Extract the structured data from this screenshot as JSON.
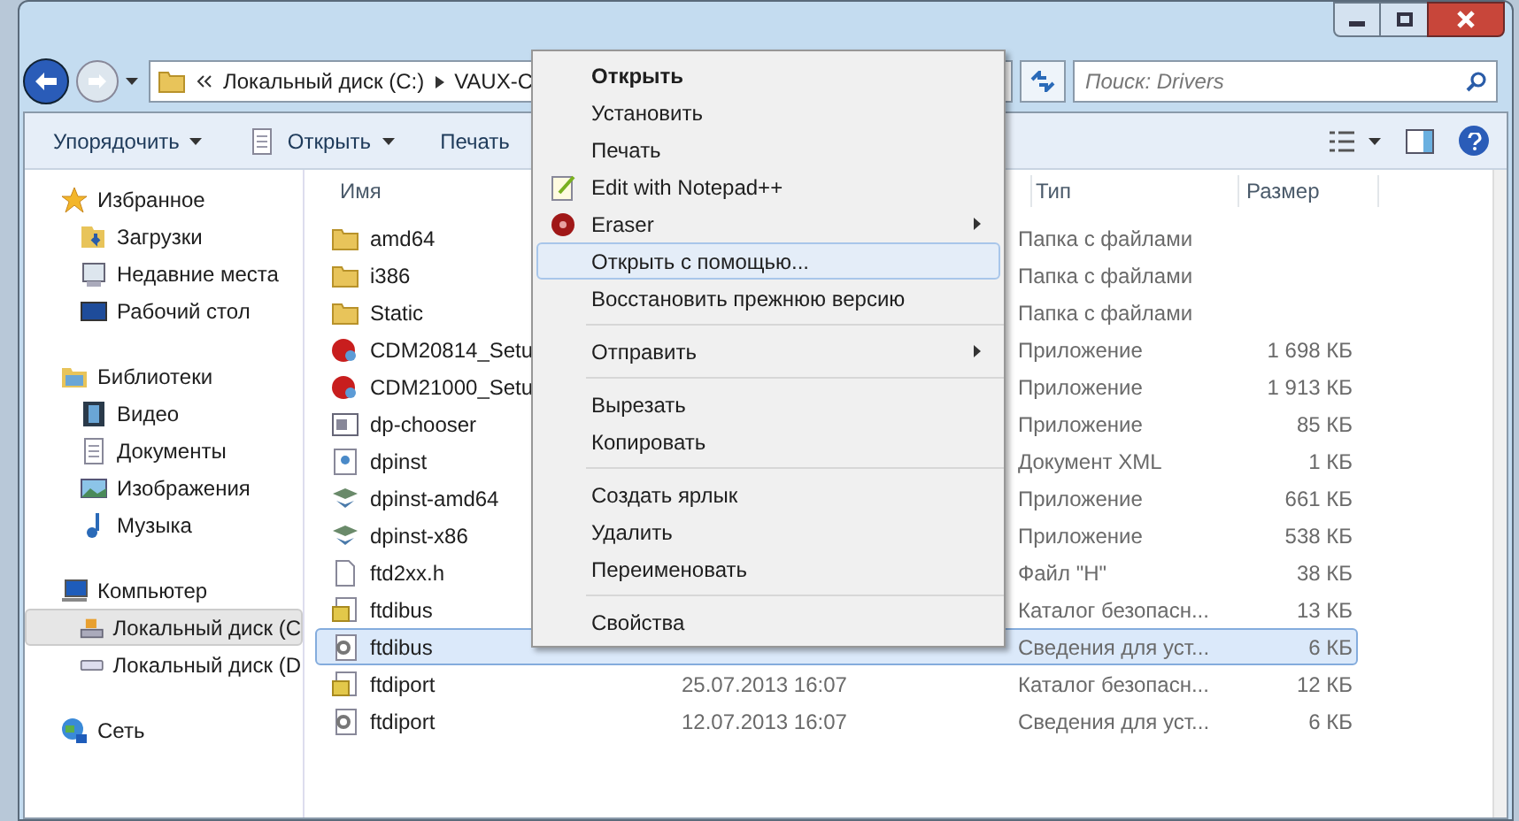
{
  "address_bar": {
    "parts": [
      "Локальный диск (C:)",
      "VAUX-C"
    ]
  },
  "search": {
    "placeholder": "Поиск: Drivers"
  },
  "toolbar": [
    {
      "label": "Упорядочить",
      "kind": "menu"
    },
    {
      "label": "Открыть",
      "kind": "open"
    },
    {
      "label": "Печать",
      "kind": "plain"
    }
  ],
  "sidebar": {
    "groups": [
      {
        "label": "Избранное",
        "children": [
          {
            "label": "Загрузки",
            "selected": false
          },
          {
            "label": "Недавние места",
            "selected": false
          },
          {
            "label": "Рабочий стол",
            "selected": false
          }
        ]
      },
      {
        "label": "Библиотеки",
        "children": [
          {
            "label": "Видео",
            "selected": false
          },
          {
            "label": "Документы",
            "selected": false
          },
          {
            "label": "Изображения",
            "selected": false
          },
          {
            "label": "Музыка",
            "selected": false
          }
        ]
      },
      {
        "label": "Компьютер",
        "children": [
          {
            "label": "Локальный диск (C",
            "selected": true
          },
          {
            "label": "Локальный диск (D",
            "selected": false
          }
        ]
      },
      {
        "label": "Сеть"
      }
    ]
  },
  "table": {
    "columns": [
      "Имя",
      "Тип",
      "Размер"
    ],
    "rows": [
      {
        "name": "amd64",
        "kind": "folder",
        "type": "Папка с файлами",
        "selected": false
      },
      {
        "name": "i386",
        "kind": "folder",
        "type": "Папка с файлами",
        "selected": false
      },
      {
        "name": "Static",
        "kind": "folder",
        "type": "Папка с файлами",
        "selected": false
      },
      {
        "name": "CDM20814_Setu",
        "kind": "setup",
        "type": "Приложение",
        "size": "1 698 КБ",
        "selected": false
      },
      {
        "name": "CDM21000_Setu",
        "kind": "setup",
        "type": "Приложение",
        "size": "1 913 КБ",
        "selected": false
      },
      {
        "name": "dp-chooser",
        "kind": "app",
        "type": "Приложение",
        "size": "85 КБ",
        "selected": false
      },
      {
        "name": "dpinst",
        "kind": "xml",
        "type": "Документ XML",
        "size": "1 КБ",
        "selected": false
      },
      {
        "name": "dpinst-amd64",
        "kind": "installer",
        "type": "Приложение",
        "size": "661 КБ",
        "selected": false
      },
      {
        "name": "dpinst-x86",
        "kind": "installer",
        "type": "Приложение",
        "size": "538 КБ",
        "selected": false
      },
      {
        "name": "ftd2xx.h",
        "kind": "file",
        "type": "Файл \"H\"",
        "size": "38 КБ",
        "selected": false
      },
      {
        "name": "ftdibus",
        "kind": "catalog",
        "type": "Каталог безопасн...",
        "size": "13 КБ",
        "selected": false
      },
      {
        "name": "ftdibus",
        "kind": "inf",
        "type": "Сведения для уст...",
        "size": "6 КБ",
        "selected": true
      },
      {
        "name": "ftdiport",
        "kind": "catalog",
        "date": "25.07.2013 16:07",
        "type": "Каталог безопасн...",
        "size": "12 КБ",
        "selected": false
      },
      {
        "name": "ftdiport",
        "kind": "inf",
        "date": "12.07.2013 16:07",
        "type": "Сведения для уст...",
        "size": "6 КБ",
        "selected": false
      }
    ]
  },
  "context_menu": [
    {
      "kind": "item",
      "label": "Открыть",
      "bold": true,
      "selected": false
    },
    {
      "kind": "item",
      "label": "Установить",
      "bold": false,
      "selected": false
    },
    {
      "kind": "item",
      "label": "Печать",
      "bold": false,
      "selected": false
    },
    {
      "kind": "notepad",
      "label": "Edit with Notepad++",
      "bold": false,
      "selected": false
    },
    {
      "kind": "eraser",
      "label": "Eraser",
      "bold": false,
      "selected": false
    },
    {
      "kind": "item",
      "label": "Открыть с помощью...",
      "bold": false,
      "selected": true
    },
    {
      "kind": "item",
      "label": "Восстановить прежнюю версию",
      "bold": false,
      "selected": false
    },
    {
      "kind": "separator"
    },
    {
      "kind": "submenu",
      "label": "Отправить",
      "bold": false,
      "selected": false
    },
    {
      "kind": "separator"
    },
    {
      "kind": "item",
      "label": "Вырезать",
      "bold": false,
      "selected": false
    },
    {
      "kind": "item",
      "label": "Копировать",
      "bold": false,
      "selected": false
    },
    {
      "kind": "separator"
    },
    {
      "kind": "item",
      "label": "Создать ярлык",
      "bold": false,
      "selected": false
    },
    {
      "kind": "item",
      "label": "Удалить",
      "bold": false,
      "selected": false
    },
    {
      "kind": "item",
      "label": "Переименовать",
      "bold": false,
      "selected": false
    },
    {
      "kind": "separator"
    },
    {
      "kind": "item",
      "label": "Свойства",
      "bold": false,
      "selected": false
    }
  ]
}
